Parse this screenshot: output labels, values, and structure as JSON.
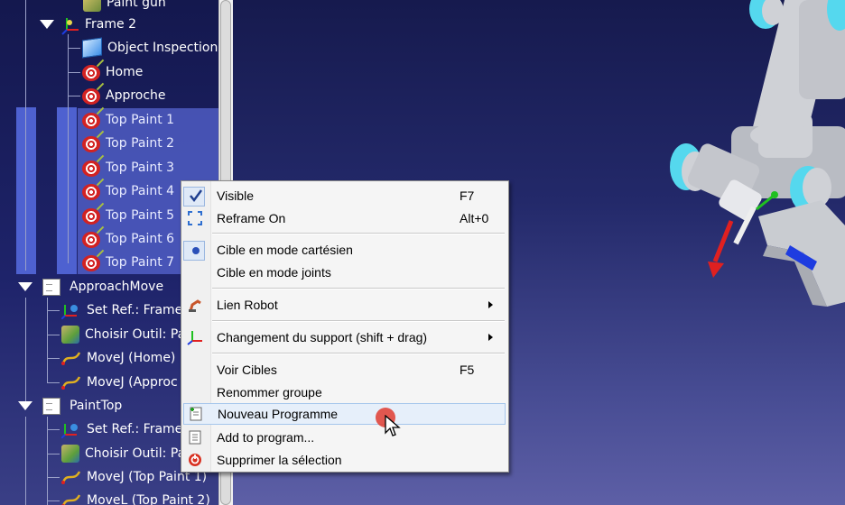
{
  "tree": {
    "items": [
      {
        "label": "Paint gun",
        "icon": "paint-gun-icon"
      },
      {
        "label": "Frame 2",
        "icon": "frame-icon"
      },
      {
        "label": "Object Inspection",
        "icon": "cube-icon"
      },
      {
        "label": "Home",
        "icon": "target-icon"
      },
      {
        "label": "Approche",
        "icon": "target-icon"
      },
      {
        "label": "Top Paint 1",
        "icon": "target-icon"
      },
      {
        "label": "Top Paint 2",
        "icon": "target-icon"
      },
      {
        "label": "Top Paint 3",
        "icon": "target-icon"
      },
      {
        "label": "Top Paint 4",
        "icon": "target-icon"
      },
      {
        "label": "Top Paint 5",
        "icon": "target-icon"
      },
      {
        "label": "Top Paint 6",
        "icon": "target-icon"
      },
      {
        "label": "Top Paint 7",
        "icon": "target-icon"
      },
      {
        "label": "ApproachMove",
        "icon": "program-icon"
      },
      {
        "label": "Set Ref.: Frame",
        "icon": "set-reference-icon"
      },
      {
        "label": "Choisir Outil: Pa",
        "icon": "tool-icon"
      },
      {
        "label": "MoveJ (Home)",
        "icon": "move-icon"
      },
      {
        "label": "MoveJ (Approc",
        "icon": "move-icon"
      },
      {
        "label": "PaintTop",
        "icon": "program-icon"
      },
      {
        "label": "Set Ref.: Frame",
        "icon": "set-reference-icon"
      },
      {
        "label": "Choisir Outil: Pa",
        "icon": "tool-icon"
      },
      {
        "label": "MoveJ (Top Paint 1)",
        "icon": "move-icon"
      },
      {
        "label": "MoveL (Top Paint 2)",
        "icon": "move-icon"
      }
    ],
    "selection_color": "#4e61d0"
  },
  "menu": {
    "visible": {
      "label": "Visible",
      "shortcut": "F7"
    },
    "reframe": {
      "label": "Reframe On",
      "shortcut": "Alt+0"
    },
    "cartesian": {
      "label": "Cible en mode cartésien"
    },
    "joints": {
      "label": "Cible en mode joints"
    },
    "link_robot": {
      "label": "Lien Robot"
    },
    "change_support": {
      "label": "Changement du support (shift + drag)"
    },
    "show_targets": {
      "label": "Voir Cibles",
      "shortcut": "F5"
    },
    "rename_group": {
      "label": "Renommer groupe"
    },
    "new_program": {
      "label": "Nouveau Programme"
    },
    "add_to_program": {
      "label": "Add to program..."
    },
    "delete_selection": {
      "label": "Supprimer la sélection"
    }
  },
  "colors": {
    "robot_body": "#cfd1d6",
    "robot_joint": "#55d8ee",
    "axis_x": "#e02020",
    "axis_y": "#20c020",
    "axis_z": "#1e3ce0",
    "cursor_highlight": "#e0463c"
  }
}
